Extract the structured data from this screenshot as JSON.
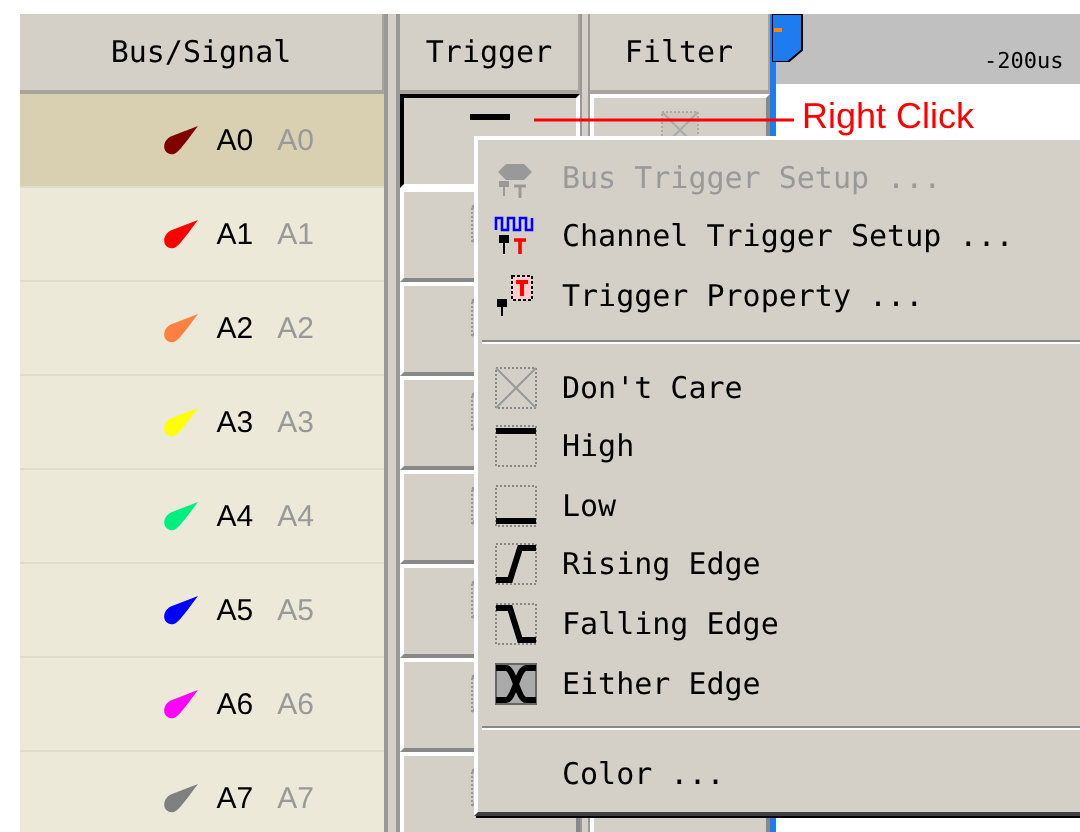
{
  "columns": [
    "Bus/Signal",
    "Trigger",
    "Filter"
  ],
  "signals": [
    {
      "name": "A0",
      "alias": "A0",
      "color": "#800000",
      "selected": true
    },
    {
      "name": "A1",
      "alias": "A1",
      "color": "#ff0000",
      "selected": false
    },
    {
      "name": "A2",
      "alias": "A2",
      "color": "#ff8040",
      "selected": false
    },
    {
      "name": "A3",
      "alias": "A3",
      "color": "#ffff00",
      "selected": false
    },
    {
      "name": "A4",
      "alias": "A4",
      "color": "#00f080",
      "selected": false
    },
    {
      "name": "A5",
      "alias": "A5",
      "color": "#0000ff",
      "selected": false
    },
    {
      "name": "A6",
      "alias": "A6",
      "color": "#ff00ff",
      "selected": false
    },
    {
      "name": "A7",
      "alias": "A7",
      "color": "#808080",
      "selected": false
    }
  ],
  "timeline": {
    "tick_label": "-200us"
  },
  "annotation": {
    "label": "Right Click"
  },
  "context_menu": {
    "items": [
      {
        "kind": "command",
        "label": "Bus Trigger Setup ...",
        "disabled": true
      },
      {
        "kind": "command",
        "label": "Channel Trigger Setup ...",
        "disabled": false
      },
      {
        "kind": "command",
        "label": "Trigger Property ...",
        "disabled": false
      },
      {
        "kind": "separator"
      },
      {
        "kind": "command",
        "label": "Don't Care",
        "disabled": false
      },
      {
        "kind": "command",
        "label": "High",
        "disabled": false
      },
      {
        "kind": "command",
        "label": "Low",
        "disabled": false
      },
      {
        "kind": "command",
        "label": "Rising Edge",
        "disabled": false
      },
      {
        "kind": "command",
        "label": "Falling Edge",
        "disabled": false
      },
      {
        "kind": "command",
        "label": "Either Edge",
        "disabled": false
      },
      {
        "kind": "separator"
      },
      {
        "kind": "command",
        "label": "Color ...",
        "disabled": false
      }
    ]
  }
}
